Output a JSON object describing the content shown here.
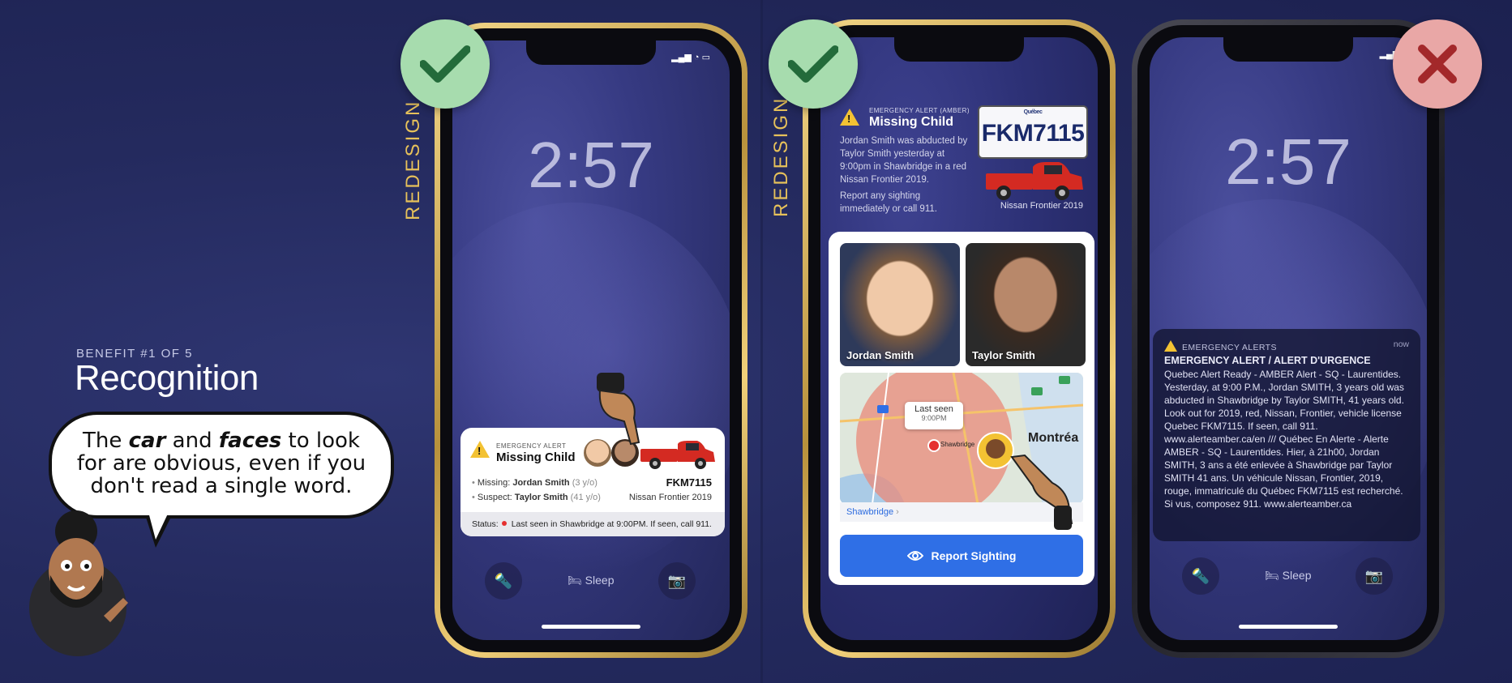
{
  "slide": {
    "benefit_label": "BENEFIT #1 OF 5",
    "title": "Recognition",
    "bubble_part1": "The ",
    "bubble_em1": "car",
    "bubble_part2": " and ",
    "bubble_em2": "faces",
    "bubble_part3": " to look for are obvious, even if you don't read a single word."
  },
  "redesign_label": "REDESIGN",
  "phone1": {
    "time": "2:57",
    "card": {
      "eyebrow": "EMERGENCY ALERT",
      "title": "Missing Child",
      "missing_label": "Missing:",
      "missing_name": "Jordan Smith",
      "missing_age": "(3 y/o)",
      "suspect_label": "Suspect:",
      "suspect_name": "Taylor Smith",
      "suspect_age": "(41 y/o)",
      "plate": "FKM7115",
      "vehicle": "Nissan Frontier 2019",
      "status_label": "Status:",
      "status_text": "Last seen in Shawbridge at 9:00PM. If seen, call 911."
    },
    "dock": {
      "sleep": "Sleep"
    }
  },
  "phone2": {
    "eyebrow": "EMERGENCY ALERT (AMBER)",
    "title": "Missing Child",
    "body": "Jordan Smith was abducted by Taylor Smith yesterday at 9:00pm in Shawbridge in a red Nissan Frontier 2019.",
    "body2": "Report any sighting immediately or call 911.",
    "plate_province": "Québec",
    "plate": "FKM7115",
    "vehicle": "Nissan Frontier 2019",
    "photo1": "Jordan Smith",
    "photo2": "Taylor Smith",
    "map_tooltip": "Last seen",
    "map_tooltip_time": "9:00PM",
    "map_city": "Montréa",
    "map_pin_label": "Shawbridge",
    "map_footer": "Shawbridge",
    "button": "Report Sighting"
  },
  "phone3": {
    "time": "2:57",
    "header": "EMERGENCY ALERTS",
    "now": "now",
    "title": "EMERGENCY ALERT / ALERT D'URGENCE",
    "body": "Quebec Alert Ready - AMBER Alert - SQ - Laurentides. Yesterday, at 9:00 P.M., Jordan SMITH, 3 years old was abducted in Shawbridge by Taylor SMITH, 41 years old. Look out for 2019, red, Nissan, Frontier, vehicle license Quebec FKM7115. If seen, call 911. www.alerteamber.ca/en /// Québec En Alerte - Alerte AMBER - SQ - Laurentides. Hier, à 21h00, Jordan SMITH, 3 ans a été enlevée à Shawbridge par Taylor SMITH 41 ans. Un véhicule Nissan, Frontier, 2019, rouge, immatriculé du Québec FKM7115 est recherché. Si vus, composez 911. www.alerteamber.ca",
    "dock": {
      "sleep": "Sleep"
    }
  },
  "colors": {
    "accent_gold": "#e6c15a",
    "check_green": "#a7dcae",
    "cross_red": "#e9a7a6",
    "button_blue": "#2f6fe6"
  }
}
